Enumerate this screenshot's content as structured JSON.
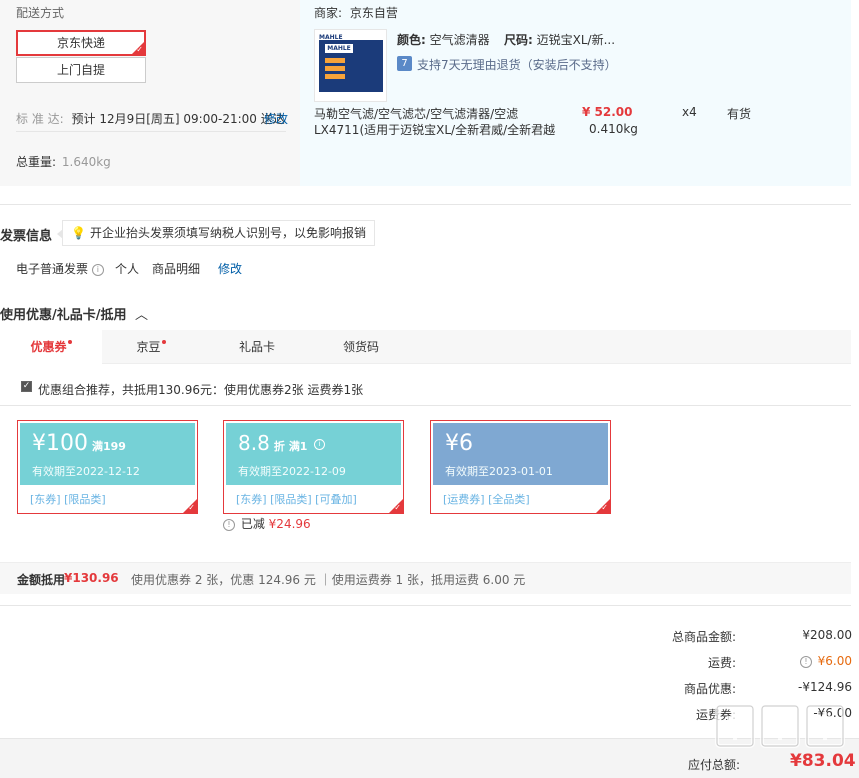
{
  "delivery": {
    "label": "配送方式",
    "options": [
      "京东快递",
      "上门自提"
    ],
    "eta_label": "标 准 达:",
    "eta_value": "预计 12月9日[周五] 09:00-21:00 送达",
    "modify": "修改",
    "weight_label": "总重量:",
    "weight_value": "1.640kg"
  },
  "shop": {
    "seller_label": "商家:",
    "seller_name": "京东自营",
    "color_label": "颜色:",
    "color_value": "空气滤清器",
    "size_label": "尺码:",
    "size_value": "迈锐宝XL/新...",
    "return_icon_text": "7",
    "return_text": "支持7天无理由退货（安装后不支持）",
    "product_title_line1": "马勒空气滤/空气滤芯/空气滤清器/空滤",
    "product_title_line2": "LX4711(适用于迈锐宝XL/全新君威/全新君越",
    "price": "¥ 52.00",
    "weight": "0.410kg",
    "quantity": "x4",
    "stock": "有货",
    "image_brand": "MAHLE"
  },
  "invoice": {
    "title": "发票信息",
    "tip": "开企业抬头发票须填写纳税人识别号，以免影响报销",
    "type": "电子普通发票",
    "title_type": "个人",
    "content": "商品明细",
    "modify": "修改"
  },
  "coupons": {
    "section_title": "使用优惠/礼品卡/抵用",
    "tabs": [
      {
        "label": "优惠券",
        "dot": true
      },
      {
        "label": "京豆",
        "dot": true
      },
      {
        "label": "礼品卡",
        "dot": false
      },
      {
        "label": "领货码",
        "dot": false
      }
    ],
    "combo_text": "优惠组合推荐，共抵用130.96元：使用优惠券2张 运费券1张",
    "items": [
      {
        "amount": "¥100",
        "condition": "满199",
        "expiry": "有效期至2022-12-12",
        "tags": "[东券]  [限品类]"
      },
      {
        "amount": "8.8",
        "unit": "折",
        "condition": "满1",
        "expiry": "有效期至2022-12-09",
        "tags": "[东券]  [限品类]  [可叠加]"
      },
      {
        "amount": "¥6",
        "condition": "",
        "expiry": "有效期至2023-01-01",
        "tags": "[运费券]  [全品类]"
      }
    ],
    "reduced_label": "已减",
    "reduced_value": "¥24.96",
    "summary_label": "金额抵用",
    "summary_value": "¥130.96",
    "summary_detail": "使用优惠券 2 张，优惠 124.96 元 ｜使用运费券 1 张，抵用运费 6.00 元"
  },
  "totals": {
    "goods_label": "总商品金额:",
    "goods_value": "¥208.00",
    "shipping_label": "运费:",
    "shipping_value": "¥6.00",
    "discount_label": "商品优惠:",
    "discount_value": "-¥124.96",
    "shipping_coupon_label": "运费券:",
    "shipping_coupon_value": "-¥6.00",
    "payable_label": "应付总额:",
    "payable_value": "¥83.04"
  },
  "watermark": "值得买",
  "colors": {
    "accent_red": "#e4393c",
    "link_blue": "#005ea7",
    "coupon_teal": "#76d1d6",
    "coupon_blue": "#7fa8d2"
  }
}
